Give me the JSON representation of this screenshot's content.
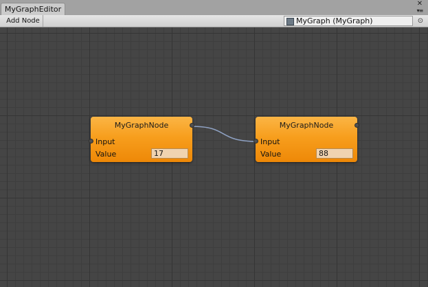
{
  "window": {
    "tab_title": "MyGraphEditor",
    "controls": {
      "close_icon": "close-icon",
      "menu_icon": "menu-icon"
    }
  },
  "toolbar": {
    "add_node_label": "Add Node",
    "graph_field_value": "MyGraph (MyGraph)"
  },
  "nodes": [
    {
      "title": "MyGraphNode",
      "input_label": "Input",
      "value_label": "Value",
      "value": "17"
    },
    {
      "title": "MyGraphNode",
      "input_label": "Input",
      "value_label": "Value",
      "value": "88"
    }
  ],
  "colors": {
    "node_top": "#fbb545",
    "node_bottom": "#ee8807",
    "wire": "#8fa2c4",
    "canvas": "#454545"
  }
}
